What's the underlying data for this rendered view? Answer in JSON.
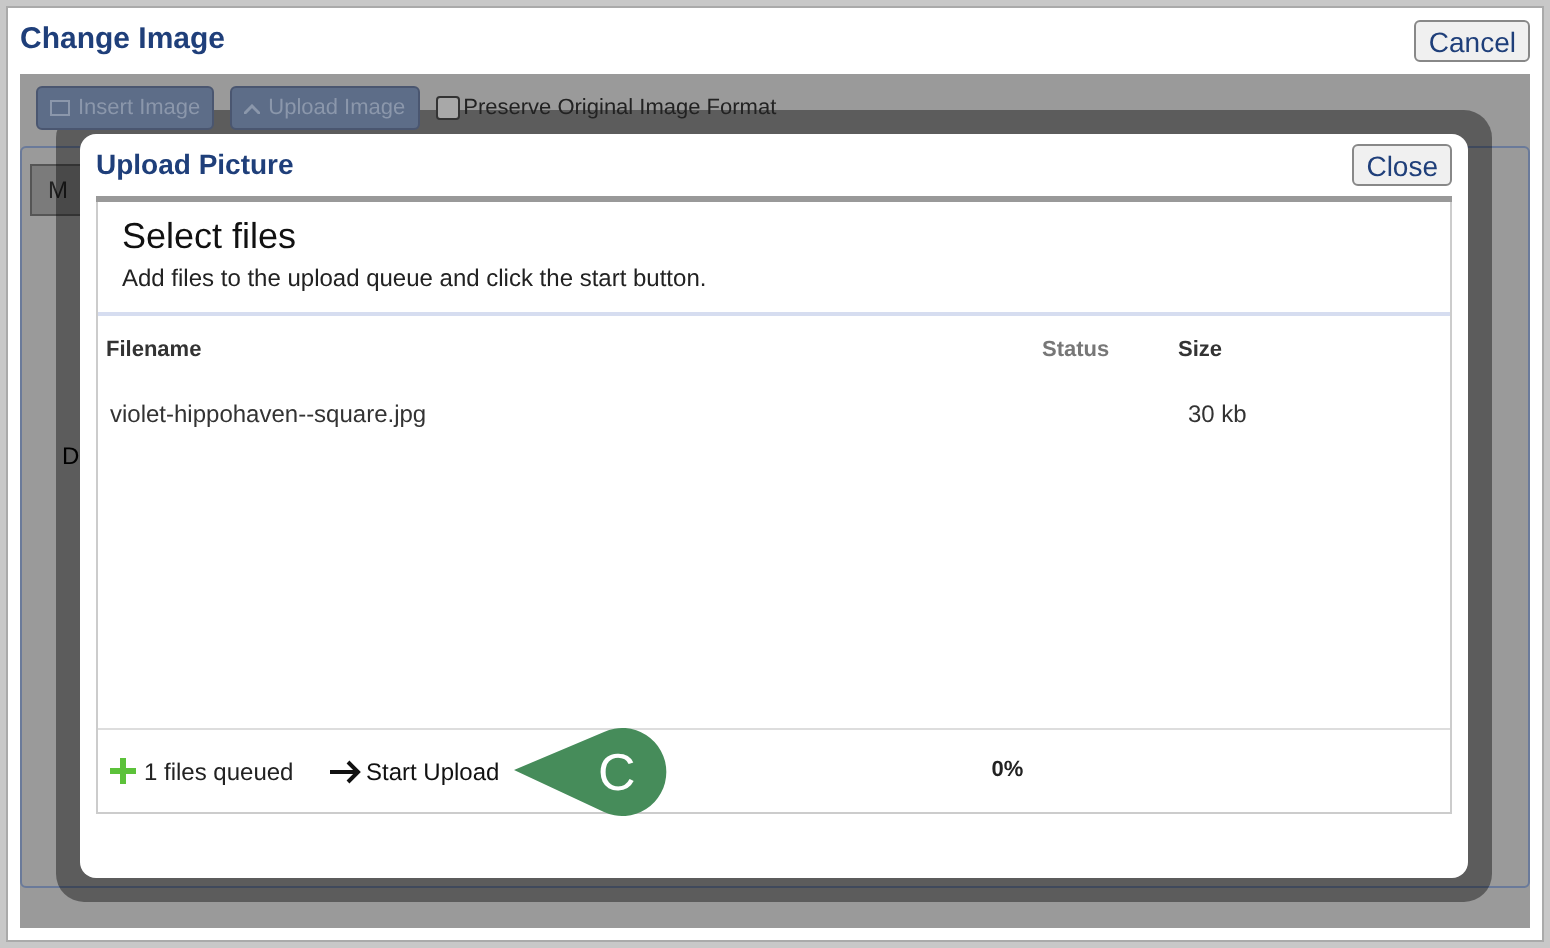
{
  "window": {
    "title": "Change Image",
    "cancel_button": "Cancel"
  },
  "toolbar": {
    "insert_button": "Insert Image",
    "upload_button": "Upload Image",
    "preserve_format": {
      "label": "Preserve Original Image Format",
      "checked": false
    }
  },
  "background": {
    "tab_label": "M",
    "side_label": "D"
  },
  "modal": {
    "title": "Upload Picture",
    "close_button": "Close",
    "heading": "Select files",
    "subtitle": "Add files to the upload queue and click the start button.",
    "columns": [
      "Filename",
      "Status",
      "Size"
    ],
    "rows": [
      {
        "filename": "violet-hippohaven--square.jpg",
        "size": "30 kb"
      }
    ],
    "footer": {
      "queued": "1 files queued",
      "start_button": "Start Upload",
      "percent": "0%"
    }
  },
  "callout": {
    "label": "C"
  }
}
